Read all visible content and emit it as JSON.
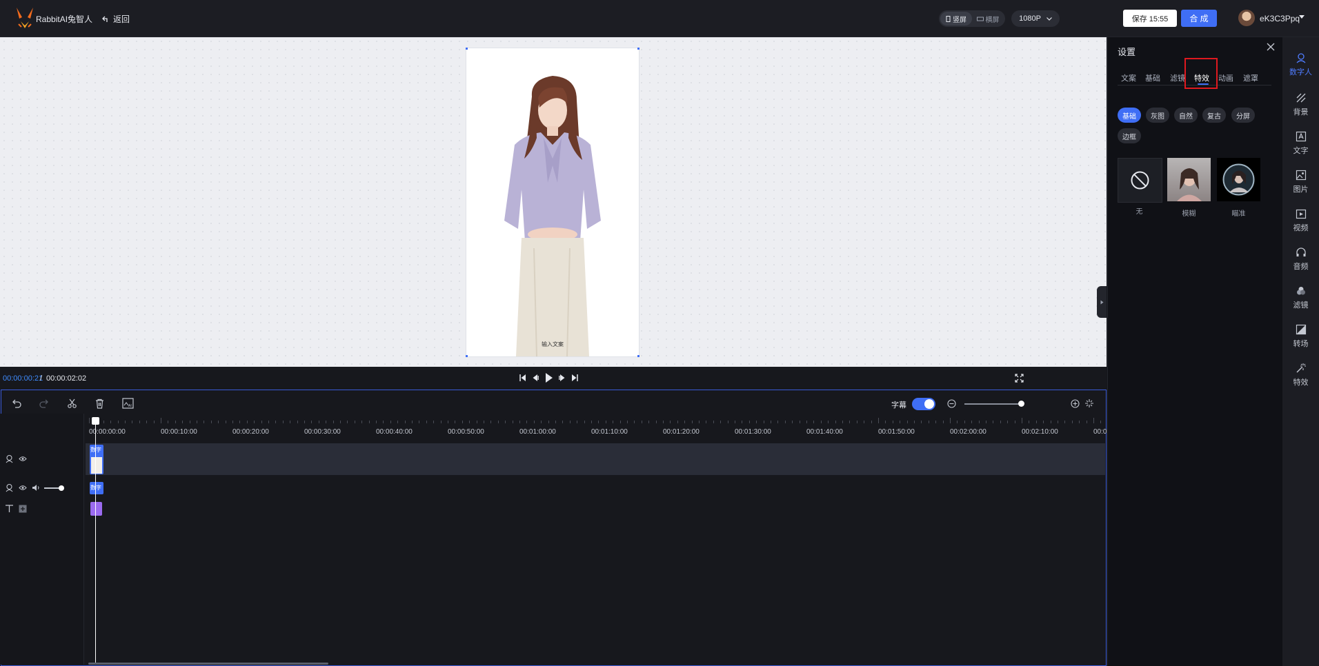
{
  "app": {
    "title": "RabbitAI兔智人",
    "back_label": "返回"
  },
  "orientation": {
    "options": [
      "竖屏",
      "横屏"
    ],
    "selected": "竖屏"
  },
  "resolution": {
    "value": "1080P"
  },
  "header_buttons": {
    "save": "保存 15:55",
    "compose": "合 成"
  },
  "user": {
    "name": "eK3C3Ppq"
  },
  "canvas": {
    "caption_placeholder": "输入文案"
  },
  "playback": {
    "current": "00:00:00:21",
    "separator": "/",
    "total": "00:00:02:02"
  },
  "timeline": {
    "subtitle_label": "字幕",
    "subtitle_on": true,
    "ruler": [
      "00:00:00:00",
      "00:00:10:00",
      "00:00:20:00",
      "00:00:30:00",
      "00:00:40:00",
      "00:00:50:00",
      "00:01:00:00",
      "00:01:10:00",
      "00:01:20:00",
      "00:01:30:00",
      "00:01:40:00",
      "00:01:50:00",
      "00:02:00:00",
      "00:02:10:00",
      "00:0"
    ],
    "clip_labels": {
      "track1": "数字",
      "track2": "数字"
    }
  },
  "panel": {
    "title": "设置",
    "tabs": [
      "文案",
      "基础",
      "滤镜",
      "特效",
      "动画",
      "遮罩"
    ],
    "active_tab": "特效",
    "effect_chips": [
      "基础",
      "灰图",
      "自然",
      "复古",
      "分屏",
      "边框"
    ],
    "active_chip": "基础",
    "thumbs": [
      {
        "label": "无",
        "icon": "none-icon"
      },
      {
        "label": "模糊",
        "icon": "portrait-thumb"
      },
      {
        "label": "瞄准",
        "icon": "circle-portrait-thumb"
      }
    ]
  },
  "sidebar": {
    "items": [
      {
        "label": "数字人",
        "icon": "digital-human-icon"
      },
      {
        "label": "背景",
        "icon": "background-icon"
      },
      {
        "label": "文字",
        "icon": "text-icon"
      },
      {
        "label": "图片",
        "icon": "image-icon"
      },
      {
        "label": "视频",
        "icon": "video-icon"
      },
      {
        "label": "音频",
        "icon": "audio-icon"
      },
      {
        "label": "滤镜",
        "icon": "filter-icon"
      },
      {
        "label": "转场",
        "icon": "transition-icon"
      },
      {
        "label": "特效",
        "icon": "effects-icon"
      }
    ],
    "active": "数字人"
  },
  "colors": {
    "accent": "#3f6ef5",
    "highlight_box": "#e0191f",
    "panel_bg": "#101116"
  }
}
